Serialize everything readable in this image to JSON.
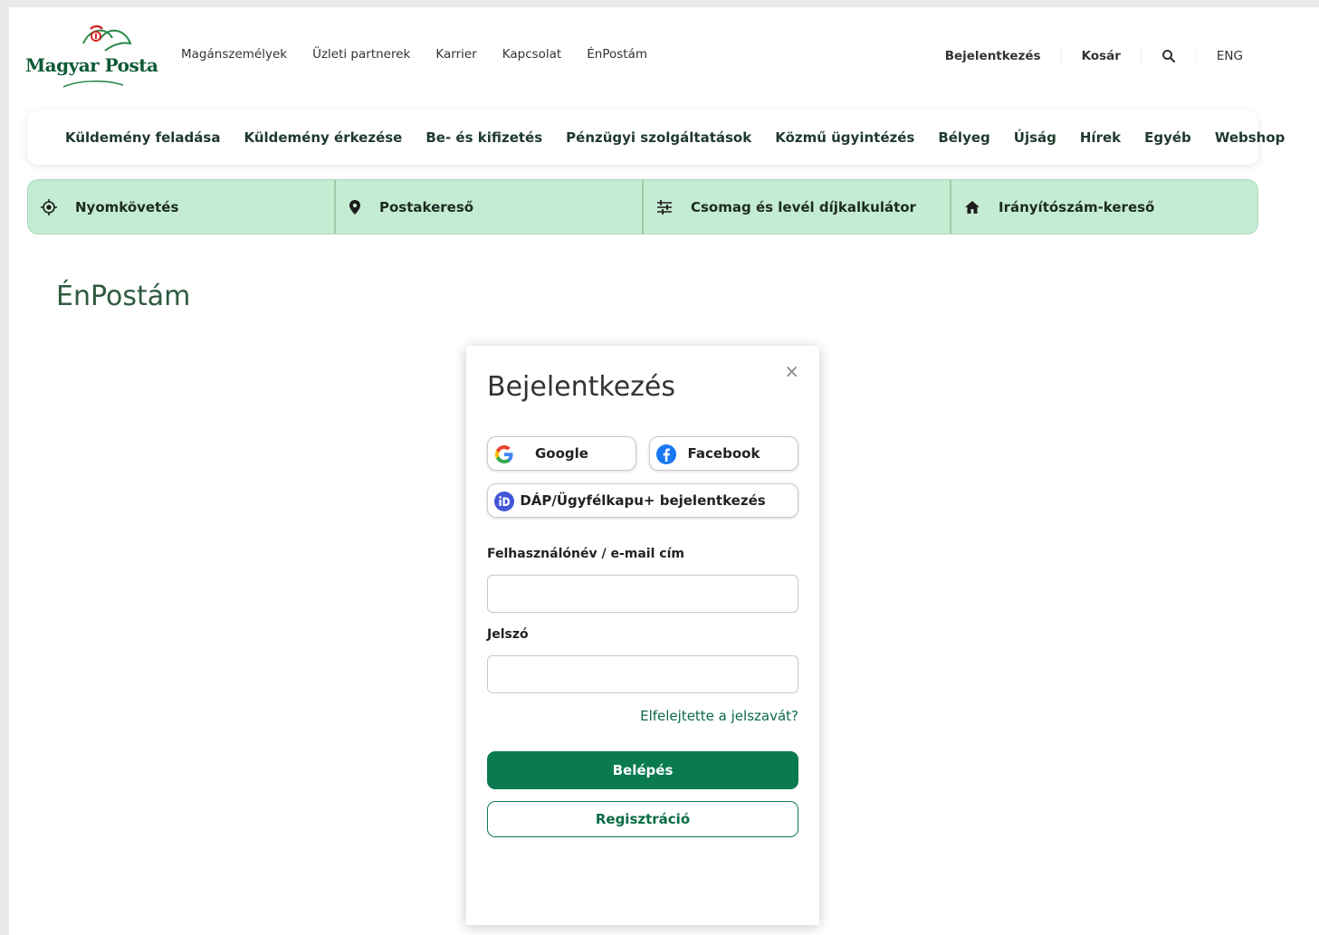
{
  "logo": {
    "text": "Magyar Posta"
  },
  "top_links": [
    "Magánszemélyek",
    "Üzleti partnerek",
    "Karrier",
    "Kapcsolat",
    "ÉnPostám"
  ],
  "top_right": {
    "login": "Bejelentkezés",
    "cart": "Kosár",
    "search_icon": "search-icon",
    "language": "ENG"
  },
  "main_nav": [
    "Küldemény feladása",
    "Küldemény érkezése",
    "Be- és kifizetés",
    "Pénzügyi szolgáltatások",
    "Közmű ügyintézés",
    "Bélyeg",
    "Újság",
    "Hírek",
    "Egyéb",
    "Webshop"
  ],
  "tools": [
    {
      "label": "Nyomkövetés",
      "icon": "target-icon"
    },
    {
      "label": "Postakereső",
      "icon": "location-pin-icon"
    },
    {
      "label": "Csomag és levél díjkalkulátor",
      "icon": "sliders-icon"
    },
    {
      "label": "Irányítószám-kereső",
      "icon": "home-icon"
    }
  ],
  "page_title": "ÉnPostám",
  "modal": {
    "close": "×",
    "title": "Bejelentkezés",
    "google": "Google",
    "facebook": "Facebook",
    "dap": "DÁP/Ügyfélkapu+ bejelentkezés",
    "username_label": "Felhasználónév / e-mail cím",
    "username_value": "",
    "password_label": "Jelszó",
    "password_value": "",
    "forgot": "Elfelejtette a jelszavát?",
    "login_button": "Belépés",
    "register_button": "Regisztráció"
  },
  "colors": {
    "brand_green": "#0a7a50",
    "tool_bg": "#c4ecd2",
    "title_green": "#2f5a40",
    "logo_red": "#d42a2a"
  }
}
